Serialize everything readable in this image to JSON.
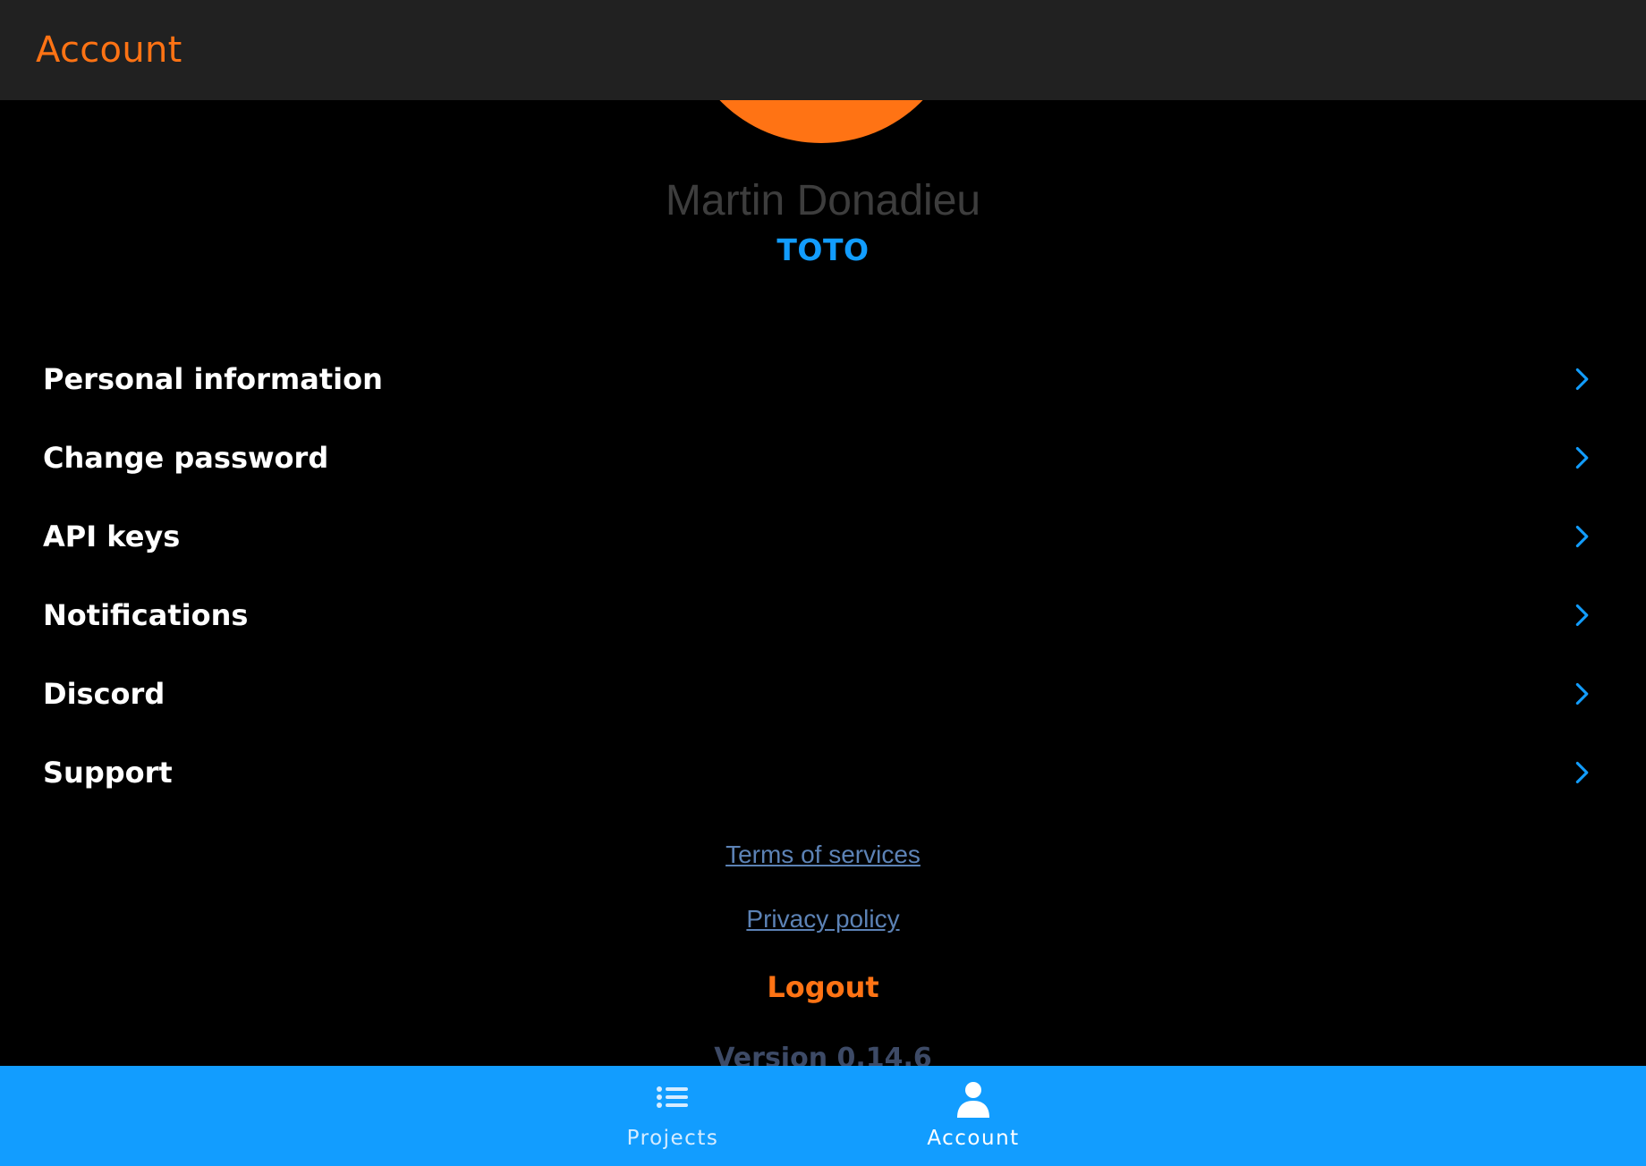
{
  "header": {
    "title": "Account"
  },
  "profile": {
    "name": "Martin Donadieu",
    "organization": "TOTO"
  },
  "menu": {
    "items": [
      {
        "label": "Personal information",
        "icon": "chevron-right-icon"
      },
      {
        "label": "Change password",
        "icon": "chevron-right-icon"
      },
      {
        "label": "API keys",
        "icon": "chevron-right-icon"
      },
      {
        "label": "Notifications",
        "icon": "chevron-right-icon"
      },
      {
        "label": "Discord",
        "icon": "chevron-right-icon"
      },
      {
        "label": "Support",
        "icon": "chevron-right-icon"
      }
    ]
  },
  "links": {
    "terms": "Terms of services",
    "privacy": "Privacy policy"
  },
  "logout_label": "Logout",
  "version": "Version 0.14.6",
  "tabbar": {
    "tabs": [
      {
        "label": "Projects",
        "icon": "list-icon",
        "active": false
      },
      {
        "label": "Account",
        "icon": "person-icon",
        "active": true
      }
    ]
  },
  "colors": {
    "accent_orange": "#ff7314",
    "accent_blue": "#129dff",
    "header_bg": "#212121",
    "background": "#000000",
    "link": "#5c82b5",
    "muted_text": "#3d3d3d",
    "tab_inactive_text": "#d6ecff",
    "tab_active_text": "#ffffff"
  }
}
